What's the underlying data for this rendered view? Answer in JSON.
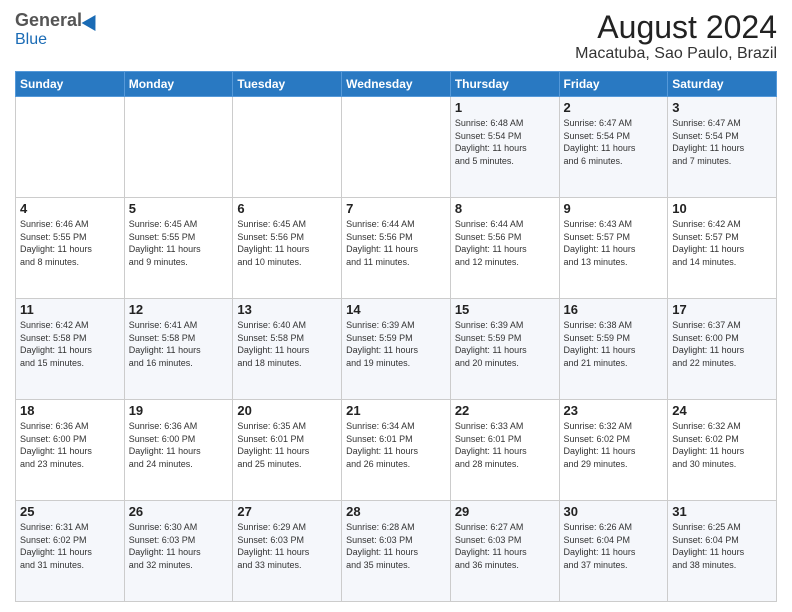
{
  "header": {
    "logo_general": "General",
    "logo_blue": "Blue",
    "month_year": "August 2024",
    "location": "Macatuba, Sao Paulo, Brazil"
  },
  "days_of_week": [
    "Sunday",
    "Monday",
    "Tuesday",
    "Wednesday",
    "Thursday",
    "Friday",
    "Saturday"
  ],
  "weeks": [
    [
      {
        "day": "",
        "info": ""
      },
      {
        "day": "",
        "info": ""
      },
      {
        "day": "",
        "info": ""
      },
      {
        "day": "",
        "info": ""
      },
      {
        "day": "1",
        "info": "Sunrise: 6:48 AM\nSunset: 5:54 PM\nDaylight: 11 hours\nand 5 minutes."
      },
      {
        "day": "2",
        "info": "Sunrise: 6:47 AM\nSunset: 5:54 PM\nDaylight: 11 hours\nand 6 minutes."
      },
      {
        "day": "3",
        "info": "Sunrise: 6:47 AM\nSunset: 5:54 PM\nDaylight: 11 hours\nand 7 minutes."
      }
    ],
    [
      {
        "day": "4",
        "info": "Sunrise: 6:46 AM\nSunset: 5:55 PM\nDaylight: 11 hours\nand 8 minutes."
      },
      {
        "day": "5",
        "info": "Sunrise: 6:45 AM\nSunset: 5:55 PM\nDaylight: 11 hours\nand 9 minutes."
      },
      {
        "day": "6",
        "info": "Sunrise: 6:45 AM\nSunset: 5:56 PM\nDaylight: 11 hours\nand 10 minutes."
      },
      {
        "day": "7",
        "info": "Sunrise: 6:44 AM\nSunset: 5:56 PM\nDaylight: 11 hours\nand 11 minutes."
      },
      {
        "day": "8",
        "info": "Sunrise: 6:44 AM\nSunset: 5:56 PM\nDaylight: 11 hours\nand 12 minutes."
      },
      {
        "day": "9",
        "info": "Sunrise: 6:43 AM\nSunset: 5:57 PM\nDaylight: 11 hours\nand 13 minutes."
      },
      {
        "day": "10",
        "info": "Sunrise: 6:42 AM\nSunset: 5:57 PM\nDaylight: 11 hours\nand 14 minutes."
      }
    ],
    [
      {
        "day": "11",
        "info": "Sunrise: 6:42 AM\nSunset: 5:58 PM\nDaylight: 11 hours\nand 15 minutes."
      },
      {
        "day": "12",
        "info": "Sunrise: 6:41 AM\nSunset: 5:58 PM\nDaylight: 11 hours\nand 16 minutes."
      },
      {
        "day": "13",
        "info": "Sunrise: 6:40 AM\nSunset: 5:58 PM\nDaylight: 11 hours\nand 18 minutes."
      },
      {
        "day": "14",
        "info": "Sunrise: 6:39 AM\nSunset: 5:59 PM\nDaylight: 11 hours\nand 19 minutes."
      },
      {
        "day": "15",
        "info": "Sunrise: 6:39 AM\nSunset: 5:59 PM\nDaylight: 11 hours\nand 20 minutes."
      },
      {
        "day": "16",
        "info": "Sunrise: 6:38 AM\nSunset: 5:59 PM\nDaylight: 11 hours\nand 21 minutes."
      },
      {
        "day": "17",
        "info": "Sunrise: 6:37 AM\nSunset: 6:00 PM\nDaylight: 11 hours\nand 22 minutes."
      }
    ],
    [
      {
        "day": "18",
        "info": "Sunrise: 6:36 AM\nSunset: 6:00 PM\nDaylight: 11 hours\nand 23 minutes."
      },
      {
        "day": "19",
        "info": "Sunrise: 6:36 AM\nSunset: 6:00 PM\nDaylight: 11 hours\nand 24 minutes."
      },
      {
        "day": "20",
        "info": "Sunrise: 6:35 AM\nSunset: 6:01 PM\nDaylight: 11 hours\nand 25 minutes."
      },
      {
        "day": "21",
        "info": "Sunrise: 6:34 AM\nSunset: 6:01 PM\nDaylight: 11 hours\nand 26 minutes."
      },
      {
        "day": "22",
        "info": "Sunrise: 6:33 AM\nSunset: 6:01 PM\nDaylight: 11 hours\nand 28 minutes."
      },
      {
        "day": "23",
        "info": "Sunrise: 6:32 AM\nSunset: 6:02 PM\nDaylight: 11 hours\nand 29 minutes."
      },
      {
        "day": "24",
        "info": "Sunrise: 6:32 AM\nSunset: 6:02 PM\nDaylight: 11 hours\nand 30 minutes."
      }
    ],
    [
      {
        "day": "25",
        "info": "Sunrise: 6:31 AM\nSunset: 6:02 PM\nDaylight: 11 hours\nand 31 minutes."
      },
      {
        "day": "26",
        "info": "Sunrise: 6:30 AM\nSunset: 6:03 PM\nDaylight: 11 hours\nand 32 minutes."
      },
      {
        "day": "27",
        "info": "Sunrise: 6:29 AM\nSunset: 6:03 PM\nDaylight: 11 hours\nand 33 minutes."
      },
      {
        "day": "28",
        "info": "Sunrise: 6:28 AM\nSunset: 6:03 PM\nDaylight: 11 hours\nand 35 minutes."
      },
      {
        "day": "29",
        "info": "Sunrise: 6:27 AM\nSunset: 6:03 PM\nDaylight: 11 hours\nand 36 minutes."
      },
      {
        "day": "30",
        "info": "Sunrise: 6:26 AM\nSunset: 6:04 PM\nDaylight: 11 hours\nand 37 minutes."
      },
      {
        "day": "31",
        "info": "Sunrise: 6:25 AM\nSunset: 6:04 PM\nDaylight: 11 hours\nand 38 minutes."
      }
    ]
  ]
}
